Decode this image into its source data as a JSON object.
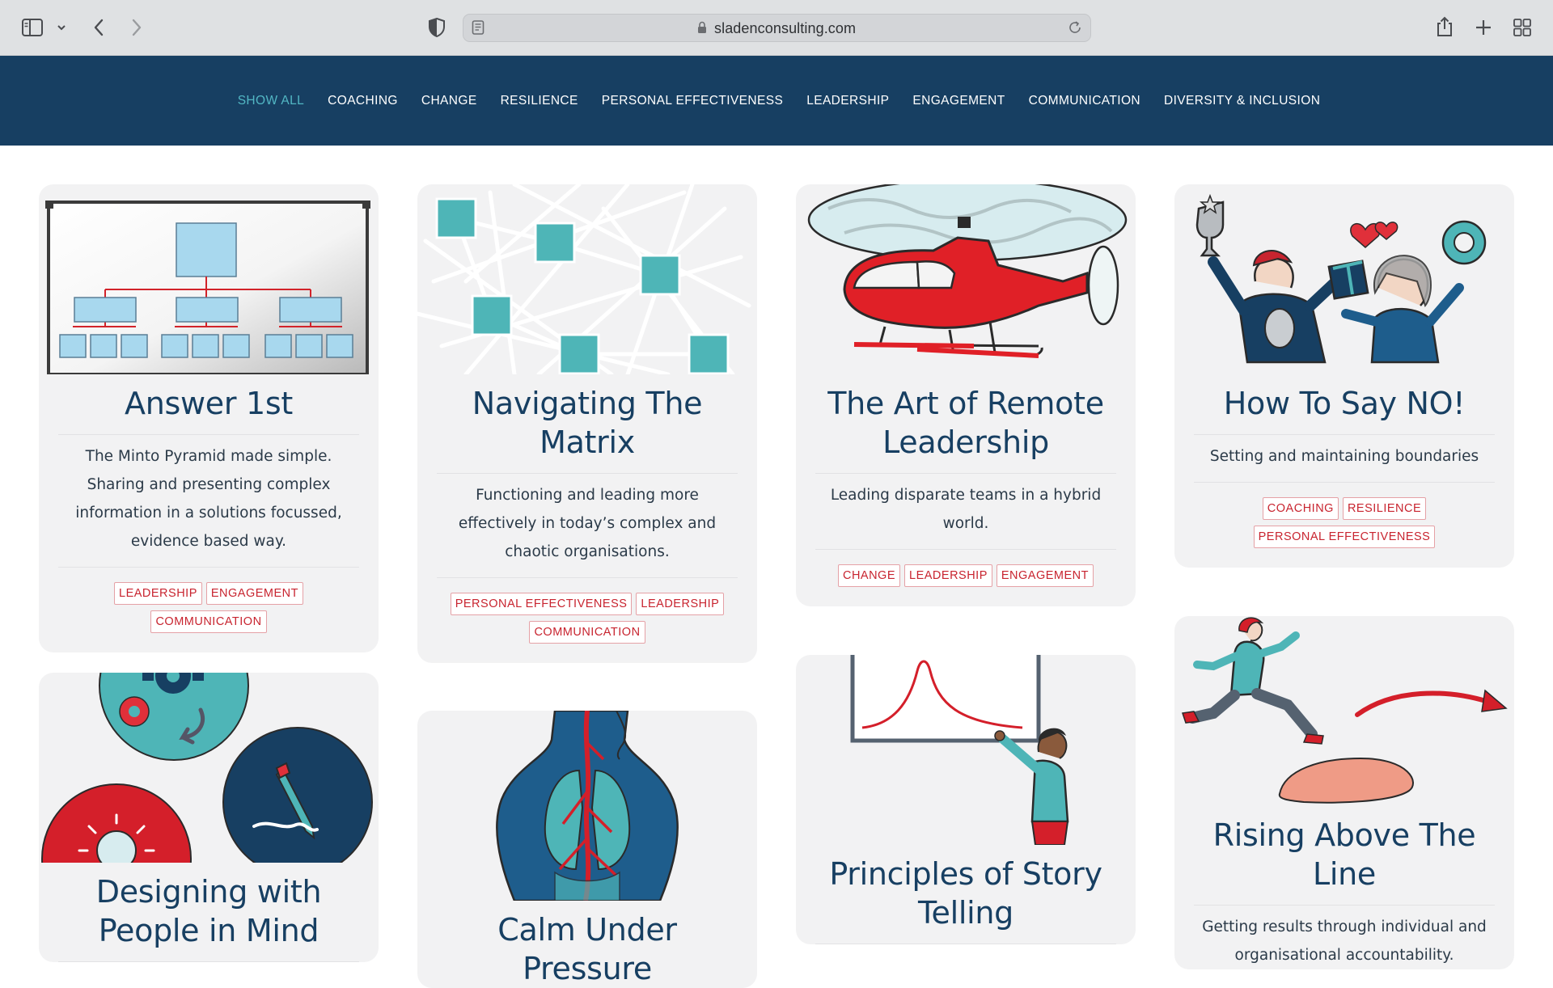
{
  "browser": {
    "url": "sladenconsulting.com"
  },
  "nav": {
    "items": [
      {
        "label": "SHOW ALL",
        "active": true
      },
      {
        "label": "COACHING"
      },
      {
        "label": "CHANGE"
      },
      {
        "label": "RESILIENCE"
      },
      {
        "label": "PERSONAL EFFECTIVENESS"
      },
      {
        "label": "LEADERSHIP"
      },
      {
        "label": "ENGAGEMENT"
      },
      {
        "label": "COMMUNICATION"
      },
      {
        "label": "DIVERSITY & INCLUSION"
      }
    ]
  },
  "colors": {
    "nav_bg": "#173f62",
    "accent_teal": "#52b7c4",
    "tag_red": "#c8242f",
    "card_bg": "#f2f2f3",
    "title_navy": "#173f62"
  },
  "cards": [
    {
      "title": "Answer 1st",
      "illustration": "pyramid-chart-whiteboard",
      "description": "The Minto Pyramid made simple. Sharing and presenting complex information in a solutions focussed, evidence based way.",
      "tags": [
        "LEADERSHIP",
        "ENGAGEMENT",
        "COMMUNICATION"
      ]
    },
    {
      "title": "Navigating The Matrix",
      "illustration": "network-matrix",
      "description": "Functioning and leading more effectively in today’s complex and chaotic organisations.",
      "tags": [
        "PERSONAL EFFECTIVENESS",
        "LEADERSHIP",
        "COMMUNICATION"
      ]
    },
    {
      "title": "The Art of Remote Leadership",
      "illustration": "red-helicopter",
      "description": "Leading disparate teams in a hybrid world.",
      "tags": [
        "CHANGE",
        "LEADERSHIP",
        "ENGAGEMENT"
      ]
    },
    {
      "title": "How To Say NO!",
      "illustration": "people-juggling-gifts",
      "description": "Setting and maintaining boundaries",
      "tags": [
        "COACHING",
        "RESILIENCE",
        "PERSONAL EFFECTIVENESS"
      ]
    },
    {
      "title": "Designing with People in Mind",
      "illustration": "gears-bulb-pencil-circles"
    },
    {
      "title": "Calm Under Pressure",
      "illustration": "human-torso-lungs"
    },
    {
      "title": "Principles of Story Telling",
      "illustration": "person-drawing-curve"
    },
    {
      "title": "Rising Above The Line",
      "illustration": "person-leaping-arrow",
      "description": "Getting results through individual and organisational accountability."
    }
  ]
}
